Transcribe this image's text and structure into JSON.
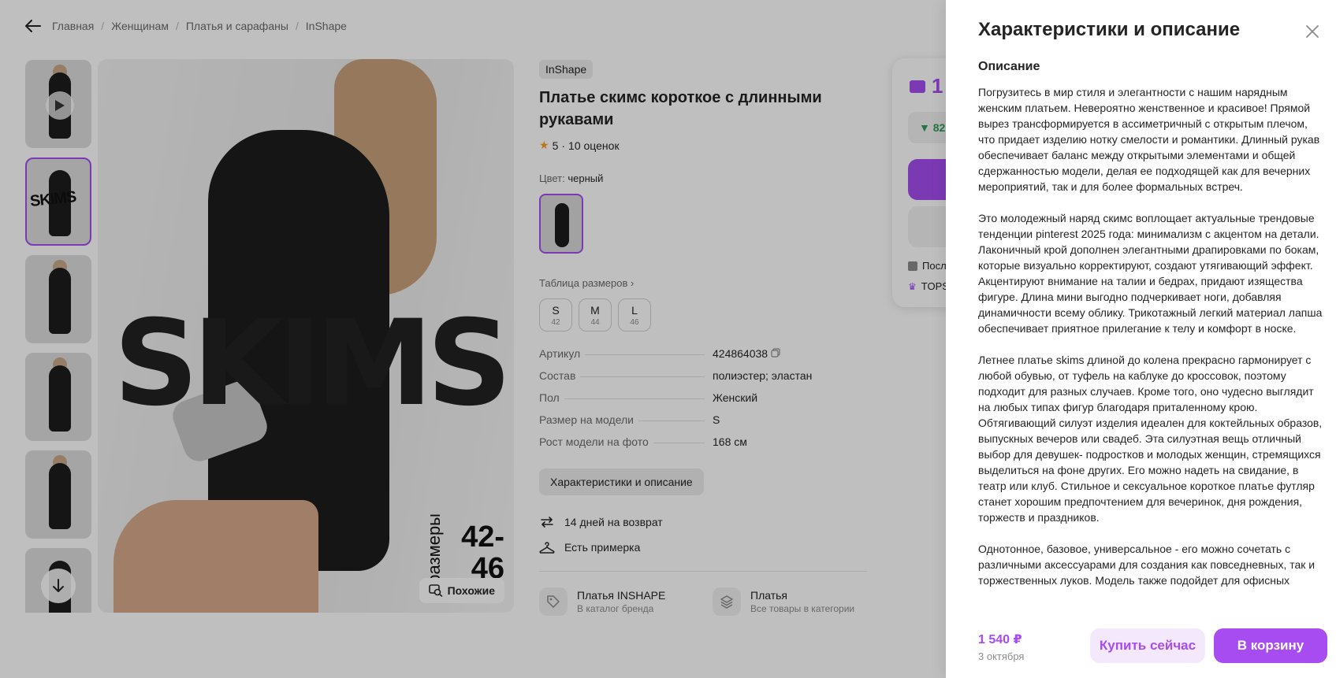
{
  "breadcrumbs": [
    "Главная",
    "Женщинам",
    "Платья и сарафаны",
    "InShape"
  ],
  "product": {
    "brand": "InShape",
    "title": "Платье скимс короткое с длинными рукавами",
    "rating": "5",
    "reviews": "10 оценок",
    "color_label": "Цвет:",
    "color_value": "черный",
    "size_table_link": "Таблица размеров",
    "sizes": [
      {
        "size": "S",
        "ru": "42"
      },
      {
        "size": "M",
        "ru": "44"
      },
      {
        "size": "L",
        "ru": "46"
      }
    ],
    "specs": [
      {
        "key": "Артикул",
        "value": "424864038"
      },
      {
        "key": "Состав",
        "value": "полиэстер; эластан"
      },
      {
        "key": "Пол",
        "value": "Женский"
      },
      {
        "key": "Размер на модели",
        "value": "S"
      },
      {
        "key": "Рост модели на фото",
        "value": "168 см"
      }
    ],
    "characteristics_button": "Характеристики и описание",
    "perks": [
      "14 дней на возврат",
      "Есть примерка"
    ],
    "links": [
      {
        "title": "Платья INSHAPE",
        "subtitle": "В каталог бренда"
      },
      {
        "title": "Платья",
        "subtitle": "Все товары в категории"
      }
    ]
  },
  "photo": {
    "brand_print": "SKIMS",
    "sizes_print_line1": "42-",
    "sizes_print_line2": "46",
    "sizes_print_vertical": "размеры",
    "similar_button": "Похожие"
  },
  "buy_card": {
    "price_partial": "1",
    "discount_partial": "▼ 82",
    "note1_partial": "Посл",
    "note2_partial": "TOPS"
  },
  "panel": {
    "title": "Характеристики и описание",
    "description_heading": "Описание",
    "paragraphs": [
      "Погрузитесь в мир стиля и элегантности с нашим нарядным женским платьем. Невероятно женственное и красивое! Прямой вырез трансформируется в ассиметричный с открытым плечом, что придает изделию нотку смелости и романтики. Длинный рукав обеспечивает баланс между открытыми элементами и общей сдержанностью модели, делая ее подходящей как для вечерних мероприятий, так и для более формальных встреч.",
      "Это молодежный наряд скимс воплощает актуальные трендовые тенденции pinterest 2025 года: минимализм с акцентом на детали. Лаконичный крой дополнен элегантными драпировками по бокам, которые визуально корректируют, создают утягивающий эффект. Акцентируют внимание на талии и бедрах, придают изящества фигуре. Длина мини выгодно подчеркивает ноги, добавляя динамичности всему облику. Трикотажный легкий материал лапша обеспечивает приятное прилегание к телу и комфорт в носке.",
      "Летнее платье skims длиной до колена прекрасно гармонирует с любой обувью, от туфель на каблуке до кроссовок, поэтому подходит для разных случаев. Кроме того, оно чудесно выглядит на любых типах фигур благодаря приталенному крою. Обтягивающий силуэт изделия идеален для коктейльных образов, выпускных вечеров или свадеб. Эта силуэтная вещь отличный выбор для девушек- подростков и молодых женщин, стремящихся выделиться на фоне других. Его можно надеть на свидание, в театр или клуб. Стильное и сексуальное короткое платье футляр станет хорошим предпочтением для вечеринок, дня рождения, торжеств и праздников.",
      "Однотонное, базовое, универсальное - его можно сочетать с различными аксессуарами для создания как повседневных, так и торжественных луков. Модель также подойдет для офисных"
    ],
    "footer_price": "1 540 ₽",
    "footer_date": "3 октября",
    "buy_now": "Купить сейчас",
    "to_cart": "В корзину"
  },
  "colors": {
    "accent": "#a64cf0",
    "accent_light": "#f4e8fd",
    "rating_star": "#ff9a1f",
    "discount_green": "#2e9e58"
  }
}
